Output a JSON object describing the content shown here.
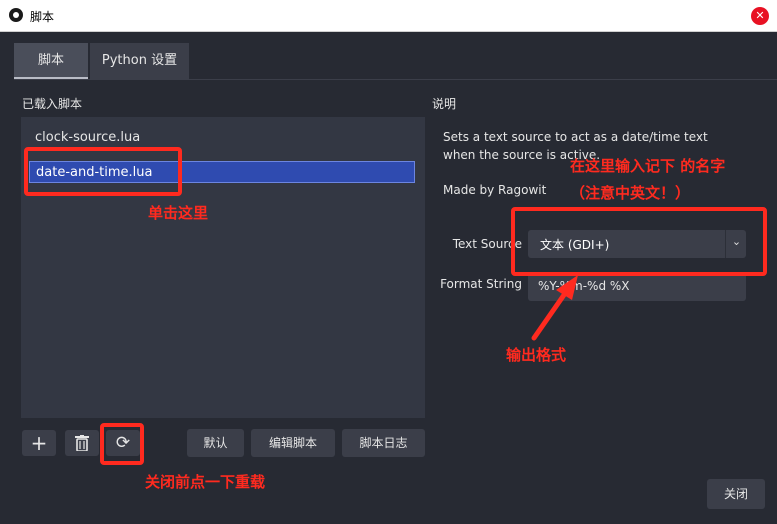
{
  "window": {
    "title": "脚本",
    "close_symbol": "✕"
  },
  "tabs": [
    {
      "label": "脚本"
    },
    {
      "label": "Python 设置"
    }
  ],
  "left_panel": {
    "header": "已载入脚本",
    "scripts": [
      {
        "name": "clock-source.lua"
      },
      {
        "name": "date-and-time.lua"
      }
    ],
    "toolbar": {
      "add_symbol": "+",
      "reload_symbol": "⟳",
      "defaults_label": "默认",
      "edit_label": "编辑脚本",
      "log_label": "脚本日志"
    }
  },
  "right_panel": {
    "header": "说明",
    "description": "Sets a text source to act as a date/time text when the source is active.",
    "made_by": "Made by Ragowit",
    "text_source_label": "Text Source",
    "text_source_value": "文本 (GDI+)",
    "format_label": "Format String",
    "format_value": "%Y-%m-%d %X"
  },
  "close_button": "关闭",
  "annotations": {
    "click_here": "单击这里",
    "enter_name_line1": "在这里输入记下 的名字",
    "enter_name_line2": "（注意中英文！）",
    "output_format": "输出格式",
    "reload_note": "关闭前点一下重载"
  },
  "colors": {
    "annotation": "#ff2a1f",
    "background": "#272a33",
    "selection": "#2f4bb0"
  }
}
